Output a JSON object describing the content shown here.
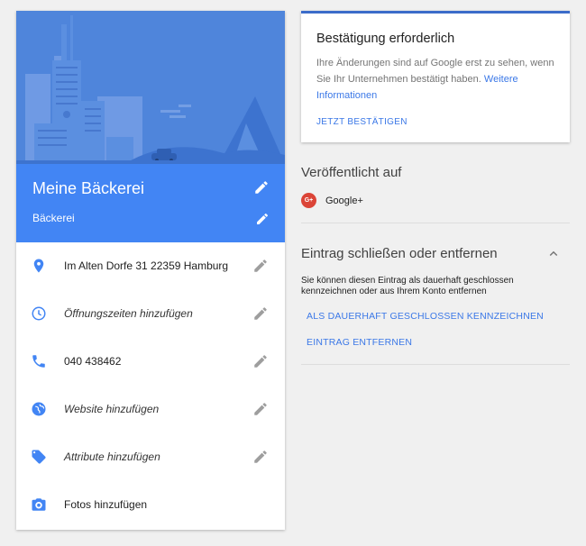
{
  "listing": {
    "business_name": "Meine Bäckerei",
    "category": "Bäckerei",
    "rows": [
      {
        "icon": "location-pin-icon",
        "label": "Im Alten Dorfe 31 22359 Hamburg",
        "placeholder": false,
        "editable": true
      },
      {
        "icon": "clock-icon",
        "label": "Öffnungszeiten hinzufügen",
        "placeholder": true,
        "editable": true
      },
      {
        "icon": "phone-icon",
        "label": "040 438462",
        "placeholder": false,
        "editable": true
      },
      {
        "icon": "globe-icon",
        "label": "Website hinzufügen",
        "placeholder": true,
        "editable": true
      },
      {
        "icon": "tag-icon",
        "label": "Attribute hinzufügen",
        "placeholder": true,
        "editable": true
      },
      {
        "icon": "camera-icon",
        "label": "Fotos hinzufügen",
        "placeholder": false,
        "editable": false
      }
    ]
  },
  "confirmation": {
    "title": "Bestätigung erforderlich",
    "text": "Ihre Änderungen sind auf Google erst zu sehen, wenn Sie Ihr Unternehmen bestätigt haben.",
    "link": "Weitere Informationen",
    "button": "JETZT BESTÄTIGEN"
  },
  "published": {
    "title": "Veröffentlicht auf",
    "items": [
      {
        "icon": "google-plus-icon",
        "icon_text": "G+",
        "label": "Google+"
      }
    ]
  },
  "close_section": {
    "title": "Eintrag schließen oder entfernen",
    "description": "Sie können diesen Eintrag als dauerhaft geschlossen kennzeichnen oder aus Ihrem Konto entfernen",
    "actions": [
      "ALS DAUERHAFT GESCHLOSSEN KENNZEICHNEN",
      "EINTRAG ENTFERNEN"
    ]
  },
  "colors": {
    "accent_blue": "#4285f4",
    "link_blue": "#3b78e7",
    "hero_blue": "#4d83d9",
    "icon_blue": "#4285f4",
    "icon_grey": "#757575",
    "google_plus_red": "#db4437",
    "background": "#f0f0f0"
  }
}
